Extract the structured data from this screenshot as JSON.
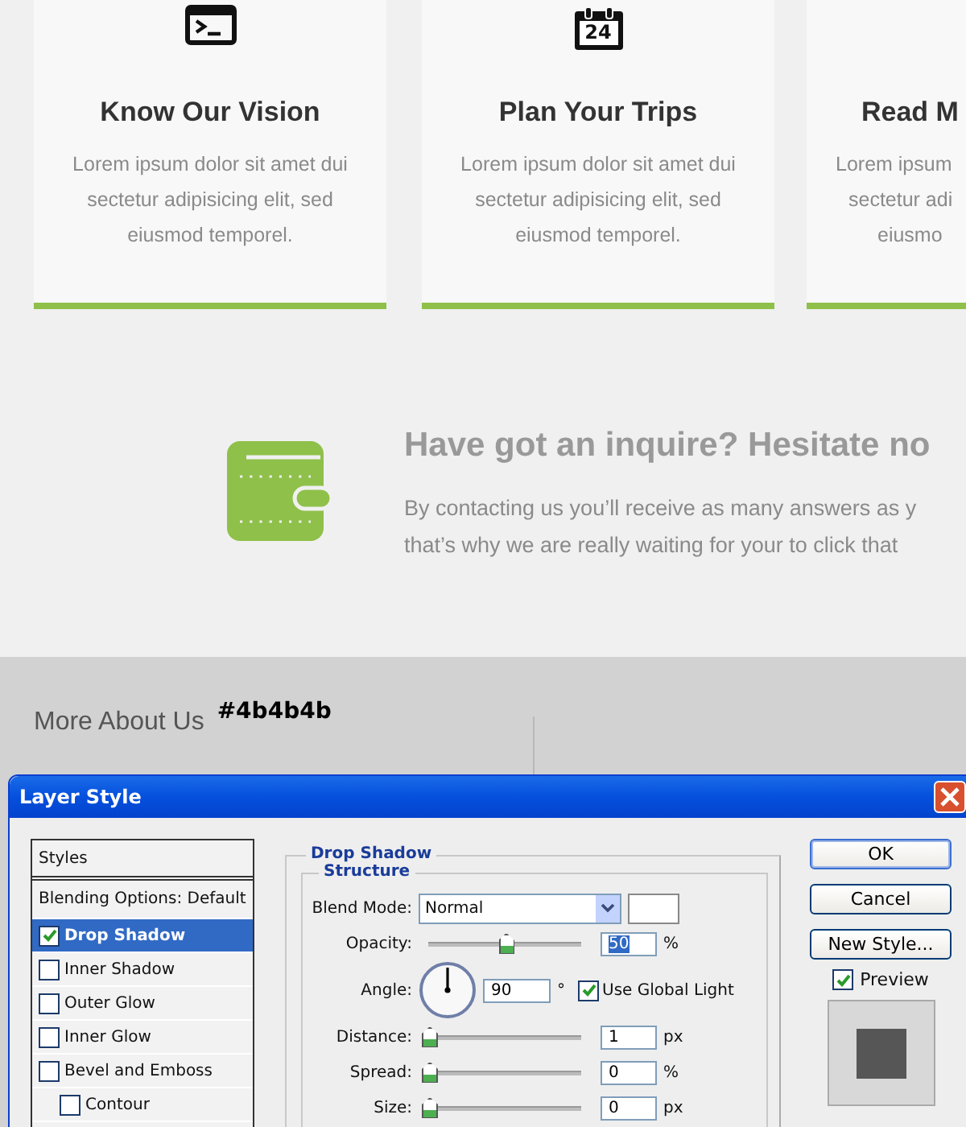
{
  "cards": [
    {
      "title": "Know Our Vision",
      "lines": [
        "Lorem ipsum dolor sit amet dui",
        "sectetur adipisicing elit, sed",
        "eiusmod temporel."
      ]
    },
    {
      "calendar_day": "24",
      "title": "Plan Your Trips",
      "lines": [
        "Lorem ipsum dolor sit amet dui",
        "sectetur adipisicing elit, sed",
        "eiusmod temporel."
      ]
    },
    {
      "title": "Read M",
      "lines": [
        "Lorem ipsum",
        "sectetur adi",
        "eiusmo"
      ]
    }
  ],
  "inquiry": {
    "title": "Have got an inquire? Hesitate no",
    "lines": [
      "By contacting us you’ll receive as many answers as y",
      "that’s why we are really waiting for your to click that"
    ]
  },
  "footer": {
    "heading": "More About Us",
    "annotation": "#4b4b4b"
  },
  "dialog": {
    "title": "Layer Style",
    "styles": [
      {
        "label": "Styles",
        "kind": "header",
        "selected": false
      },
      {
        "label": "Blending Options: Default",
        "kind": "plain",
        "selected": false
      },
      {
        "label": "Drop Shadow",
        "kind": "check",
        "checked": true,
        "selected": true
      },
      {
        "label": "Inner Shadow",
        "kind": "check",
        "checked": false,
        "selected": false
      },
      {
        "label": "Outer Glow",
        "kind": "check",
        "checked": false,
        "selected": false
      },
      {
        "label": "Inner Glow",
        "kind": "check",
        "checked": false,
        "selected": false
      },
      {
        "label": "Bevel and Emboss",
        "kind": "check",
        "checked": false,
        "selected": false
      },
      {
        "label": "Contour",
        "kind": "subcheck",
        "checked": false,
        "selected": false
      }
    ],
    "section": "Drop Shadow",
    "group": "Structure",
    "blend_mode": {
      "label": "Blend Mode:",
      "value": "Normal"
    },
    "opacity": {
      "label": "Opacity:",
      "level": 0.5,
      "value": "50",
      "value_selected": true,
      "unit": "%"
    },
    "angle": {
      "label": "Angle:",
      "value": "90",
      "unit": "°"
    },
    "global_light": {
      "label": "Use Global Light",
      "checked": true
    },
    "sliders": [
      {
        "label": "Distance:",
        "level": 0,
        "value": "1",
        "unit": "px"
      },
      {
        "label": "Spread:",
        "level": 0,
        "value": "0",
        "unit": "%"
      },
      {
        "label": "Size:",
        "level": 0,
        "value": "0",
        "unit": "px"
      }
    ],
    "buttons": [
      "OK",
      "Cancel",
      "New Style..."
    ],
    "preview": {
      "label": "Preview",
      "checked": true
    }
  }
}
